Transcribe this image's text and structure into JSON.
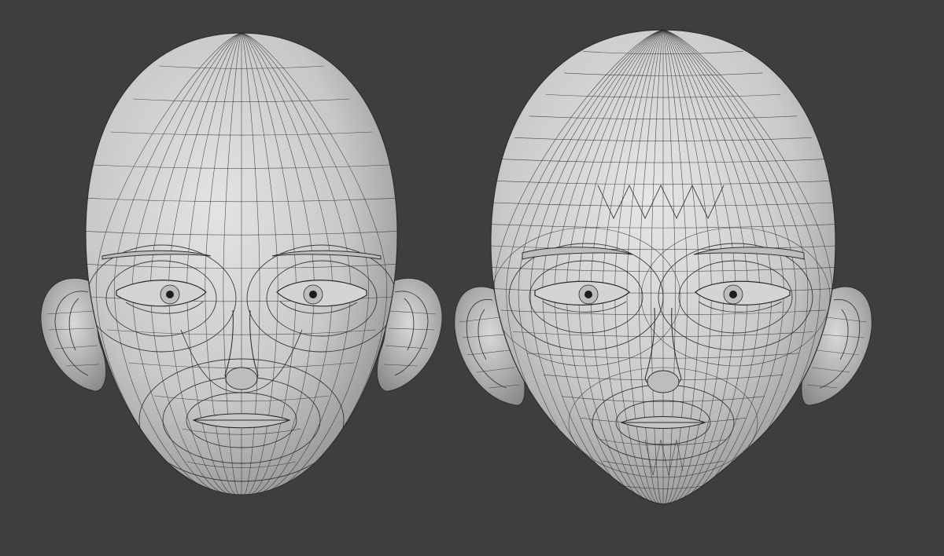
{
  "viewport": {
    "background": "#3e3e3e"
  },
  "models": [
    {
      "id": "head-low-density",
      "surface": "#c9c9c9",
      "wire": "#2a2a2a",
      "mesh": {
        "rings": 14,
        "spokes": 18
      }
    },
    {
      "id": "head-high-density",
      "surface": "#cdcdcd",
      "wire": "#2a2a2a",
      "mesh": {
        "rings": 22,
        "spokes": 30
      }
    }
  ]
}
